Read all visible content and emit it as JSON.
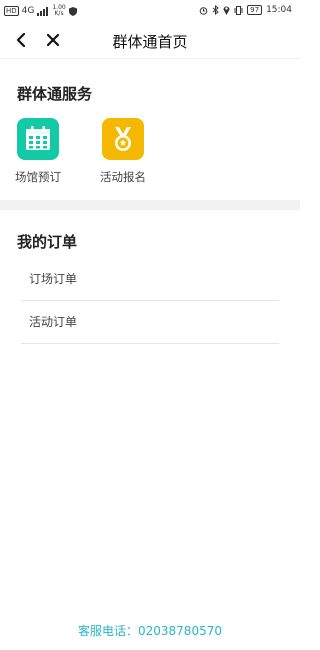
{
  "status_bar": {
    "left_hd": "HD",
    "network": "4G",
    "speed_top": "1.00",
    "speed_bottom": "K/s",
    "battery": "97",
    "time": "15:04"
  },
  "nav": {
    "title": "群体通首页",
    "back_icon": "chevron-left-icon",
    "close_icon": "close-icon"
  },
  "services": {
    "title": "群体通服务",
    "items": [
      {
        "label": "场馆预订",
        "icon": "calendar-icon",
        "color": "#14c9a6"
      },
      {
        "label": "活动报名",
        "icon": "medal-icon",
        "color": "#f5b800"
      }
    ]
  },
  "orders": {
    "title": "我的订单",
    "items": [
      {
        "label": "订场订单"
      },
      {
        "label": "活动订单"
      }
    ]
  },
  "footer": {
    "hotline": "客服电话：02038780570",
    "color": "#2bb6c9"
  }
}
